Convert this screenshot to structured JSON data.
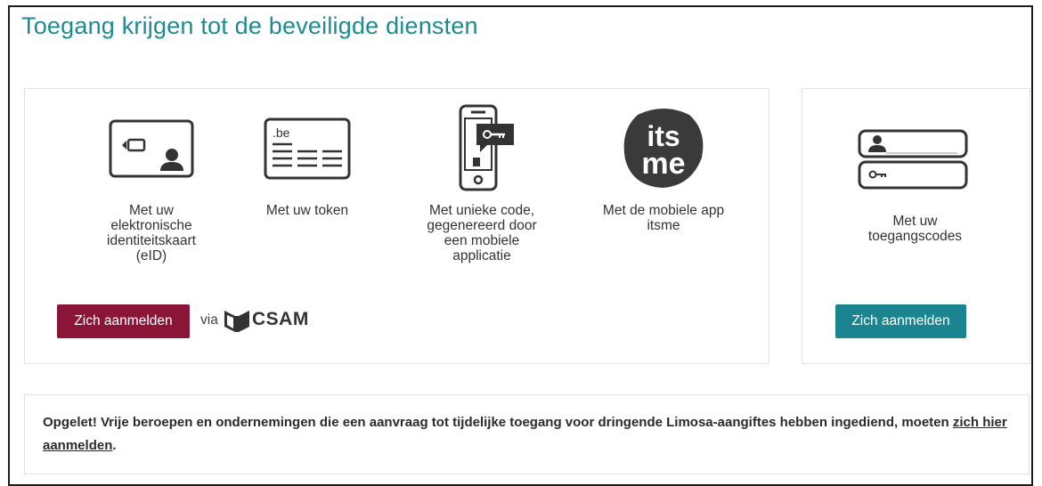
{
  "title": "Toegang krijgen tot de beveiligde diensten",
  "methods": [
    {
      "label": "Met uw elektronische identiteitskaart (eID)",
      "icon": "id-card-icon"
    },
    {
      "label": "Met uw token",
      "icon": "token-card-icon",
      "icon_text": ".be"
    },
    {
      "label": "Met unieke code, gegenereerd door een mobiele applicatie",
      "icon": "mobile-app-key-icon"
    },
    {
      "label": "Met de mobiele app itsme",
      "icon": "itsme-logo-icon",
      "logo_line1": "its",
      "logo_line2": "me"
    }
  ],
  "login_button_primary": "Zich aanmelden",
  "via_text": "via",
  "csam_text": "CSAM",
  "side": {
    "label": "Met uw toegangscodes",
    "icon": "username-password-fields-icon",
    "button": "Zich aanmelden"
  },
  "notice": {
    "text": "Opgelet! Vrije beroepen en ondernemingen die een aanvraag tot tijdelijke toegang voor dringende Limosa-aangiftes hebben ingediend, moeten ",
    "link": "zich hier aanmelden",
    "end": "."
  },
  "colors": {
    "title": "#1f8a94",
    "primary_button": "#8b1538",
    "secondary_button": "#1a8491"
  }
}
